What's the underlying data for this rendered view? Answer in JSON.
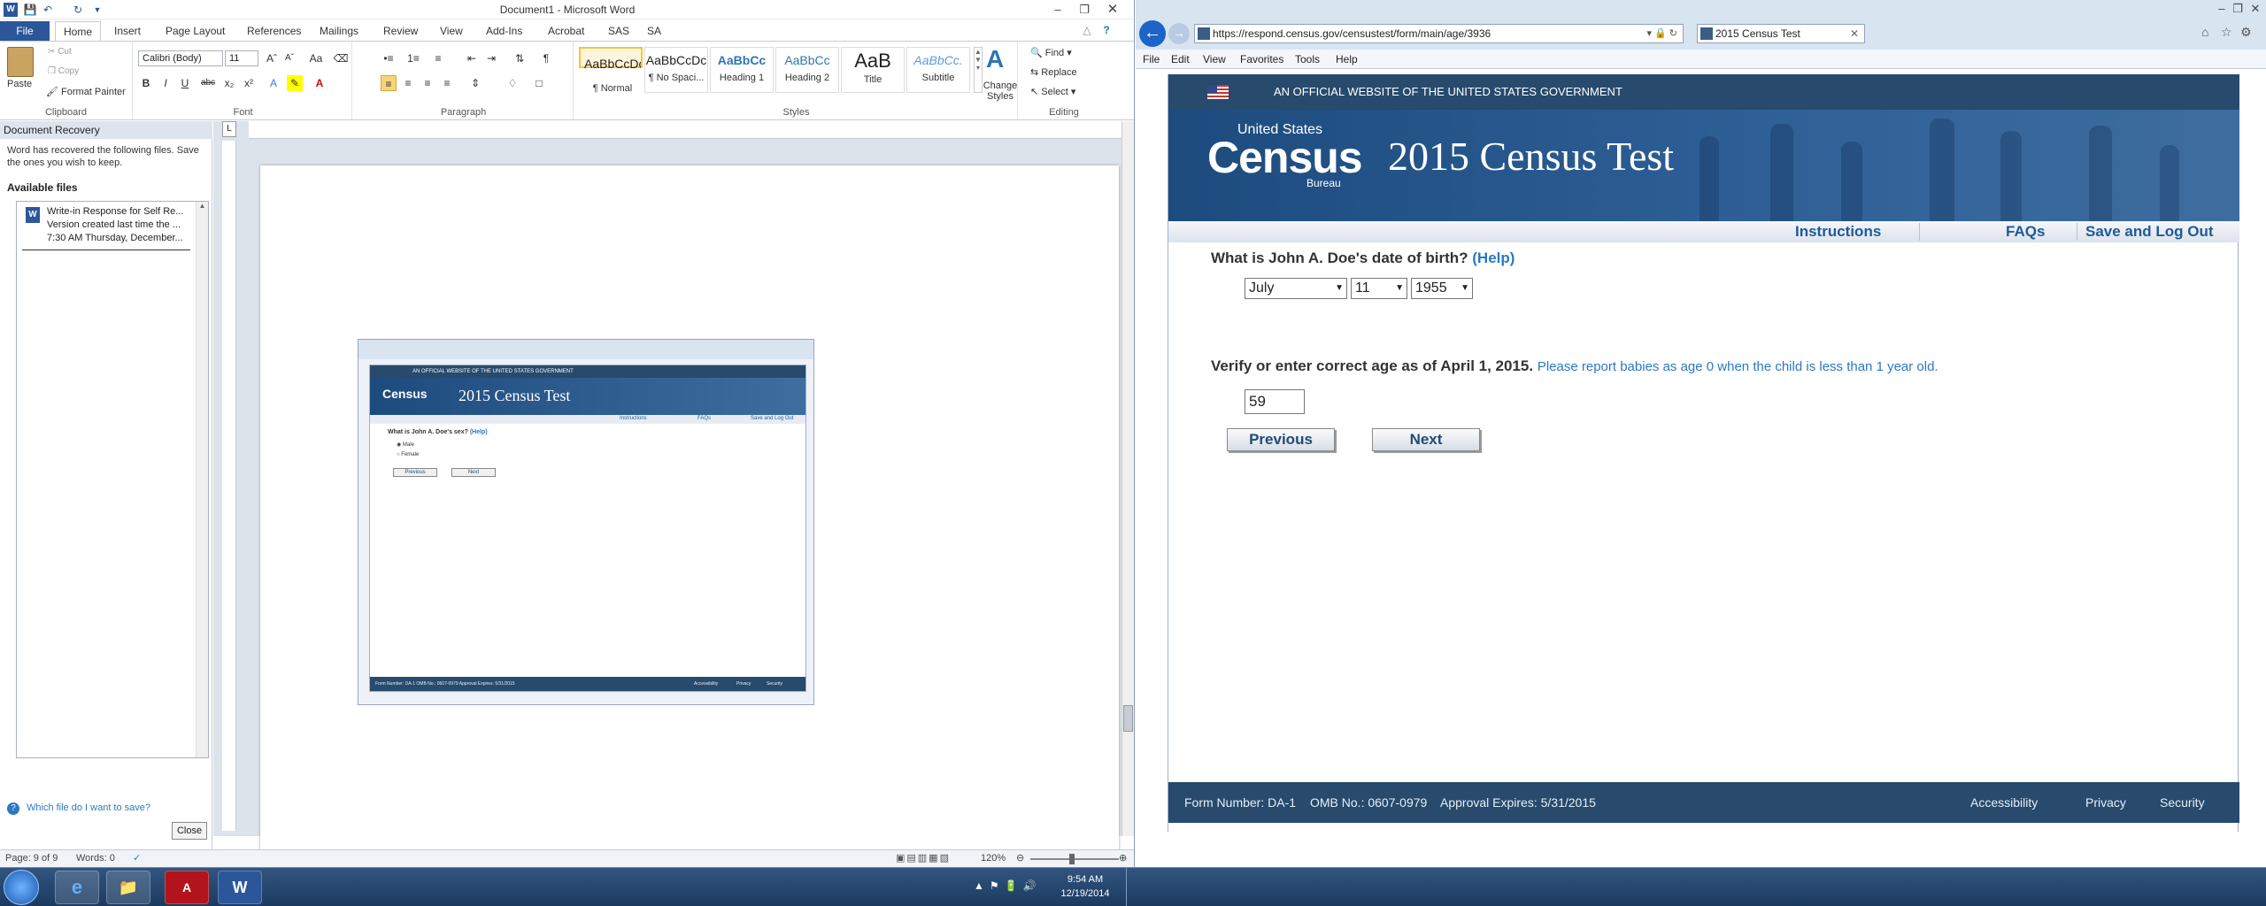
{
  "word": {
    "title": "Document1 - Microsoft Word",
    "tabs": [
      "File",
      "Home",
      "Insert",
      "Page Layout",
      "References",
      "Mailings",
      "Review",
      "View",
      "Add-Ins",
      "Acrobat",
      "SAS",
      "SA"
    ],
    "clipboard": {
      "paste": "Paste",
      "cut": "Cut",
      "copy": "Copy",
      "format_painter": "Format Painter",
      "label": "Clipboard"
    },
    "font": {
      "name": "Calibri (Body)",
      "size": "11",
      "label": "Font"
    },
    "paragraph_label": "Paragraph",
    "styles": [
      {
        "preview": "AaBbCcDc",
        "name": "¶ Normal"
      },
      {
        "preview": "AaBbCcDc",
        "name": "¶ No Spaci..."
      },
      {
        "preview": "AaBbCc",
        "name": "Heading 1"
      },
      {
        "preview": "AaBbCc",
        "name": "Heading 2"
      },
      {
        "preview": "AaB",
        "name": "Title"
      },
      {
        "preview": "AaBbCc.",
        "name": "Subtitle"
      }
    ],
    "styles_label": "Styles",
    "change_styles": "Change Styles",
    "editing": {
      "find": "Find",
      "replace": "Replace",
      "select": "Select",
      "label": "Editing"
    },
    "recovery": {
      "header": "Document Recovery",
      "message": "Word has recovered the following files.  Save the ones you wish to keep.",
      "available": "Available files",
      "file_name": "Write-in Response for Self Re...",
      "file_version": "Version created last time the ...",
      "file_time": "7:30 AM Thursday, December...",
      "which_file": "Which file do I want to save?",
      "close": "Close"
    },
    "status": {
      "page": "Page: 9 of 9",
      "words": "Words: 0",
      "zoom": "120%"
    }
  },
  "thumb": {
    "gov": "AN OFFICIAL WEBSITE OF THE UNITED STATES GOVERNMENT",
    "title": "2015 Census Test",
    "nav": [
      "Instructions",
      "FAQs",
      "Save and Log Out"
    ],
    "question": "What is John A. Doe's sex?",
    "help": "(Help)",
    "male": "Male",
    "female": "Female",
    "prev": "Previous",
    "next": "Next",
    "footer_left": "Form Number: DA-1    OMB No.: 0607-0979    Approval Expires: 5/31/2015",
    "footer_links": [
      "Accessibility",
      "Privacy",
      "Security"
    ]
  },
  "ie": {
    "url": "https://respond.census.gov/censustest/form/main/age/3936",
    "tab_title": "2015 Census Test",
    "menus": [
      "File",
      "Edit",
      "View",
      "Favorites",
      "Tools",
      "Help"
    ]
  },
  "census": {
    "gov_banner": "AN OFFICIAL WEBSITE OF THE UNITED STATES GOVERNMENT",
    "logo_top": "United States",
    "logo_main": "Census",
    "logo_sub": "Bureau",
    "title": "2015 Census Test",
    "nav": {
      "instructions": "Instructions",
      "faqs": "FAQs",
      "save": "Save and Log Out"
    },
    "dob_question": "What is John A. Doe's date of birth?",
    "help": "(Help)",
    "month": "July",
    "day": "11",
    "year": "1955",
    "age_question": "Verify or enter correct age as of April 1, 2015.",
    "age_note": "Please report babies as age 0 when the child is less than 1 year old.",
    "age_value": "59",
    "prev": "Previous",
    "next": "Next",
    "footer_form": "Form Number: DA-1",
    "footer_omb": "OMB No.: 0607-0979",
    "footer_expires": "Approval Expires: 5/31/2015",
    "footer_links": {
      "accessibility": "Accessibility",
      "privacy": "Privacy",
      "security": "Security"
    }
  },
  "taskbar": {
    "time": "9:54 AM",
    "date": "12/19/2014"
  }
}
